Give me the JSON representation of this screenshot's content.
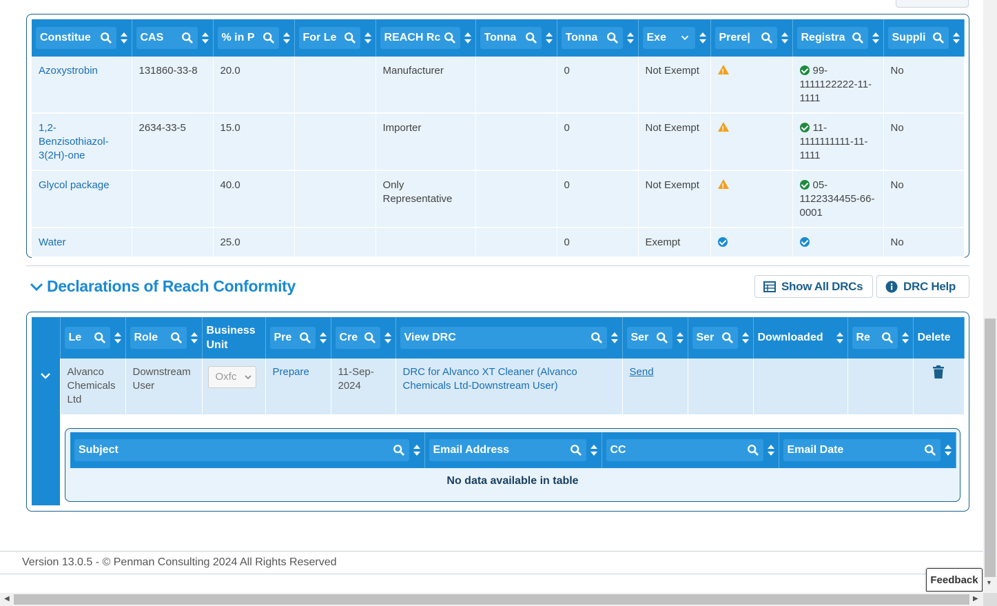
{
  "constituents": {
    "headers": [
      "Constituent",
      "CAS",
      "% in Product",
      "For Legal Entity",
      "REACH Role",
      "Tonnage",
      "Tonnage",
      "Exempt",
      "Prerequisites",
      "Registration",
      "Supplier"
    ],
    "headers_visible": [
      "Constitue",
      "CAS",
      "% in P",
      "For Le",
      "REACH Rc",
      "Tonna",
      "Tonna",
      "Exe",
      "Prere|",
      "Registra",
      "Suppli"
    ],
    "rows": [
      {
        "name": "Azoxystrobin",
        "cas": "131860-33-8",
        "pct": "20.0",
        "for_le": "",
        "reach_role": "Manufacturer",
        "tonnage1": "",
        "tonnage2": "0",
        "exempt": "Not Exempt",
        "prereq": "warning",
        "reg_status": "ok",
        "registration": "99-1111122222-11-1111",
        "supplier": "No"
      },
      {
        "name": "1,2-Benzisothiazol-3(2H)-one",
        "cas": "2634-33-5",
        "pct": "15.0",
        "for_le": "",
        "reach_role": "Importer",
        "tonnage1": "",
        "tonnage2": "0",
        "exempt": "Not Exempt",
        "prereq": "warning",
        "reg_status": "ok",
        "registration": "11-1111111111-11-1111",
        "supplier": "No"
      },
      {
        "name": "Glycol package",
        "cas": "",
        "pct": "40.0",
        "for_le": "",
        "reach_role": "Only Representative",
        "tonnage1": "",
        "tonnage2": "0",
        "exempt": "Not Exempt",
        "prereq": "warning",
        "reg_status": "ok",
        "registration": "05-1122334455-66-0001",
        "supplier": "No"
      },
      {
        "name": "Water",
        "cas": "",
        "pct": "25.0",
        "for_le": "",
        "reach_role": "",
        "tonnage1": "",
        "tonnage2": "0",
        "exempt": "Exempt",
        "prereq": "check",
        "reg_status": "check",
        "registration": "",
        "supplier": "No"
      }
    ]
  },
  "drc_section": {
    "title": "Declarations of Reach Conformity",
    "show_all_label": "Show All DRCs",
    "help_label": "DRC Help",
    "headers_visible": [
      "Le",
      "Role",
      "Business Unit",
      "Pre",
      "Cre",
      "View DRC",
      "Ser",
      "Ser",
      "Downloaded",
      "Re",
      "Delete"
    ],
    "row": {
      "legal_entity": "Alvanco Chemicals Ltd",
      "role": "Downstream User",
      "business_unit": "Oxfc",
      "prepare": "Prepare",
      "created": "11-Sep-2024",
      "view_drc": "DRC for Alvanco XT Cleaner (Alvanco Chemicals Ltd-Downstream User)",
      "send": "Send",
      "sent": "",
      "downloaded": "",
      "received": ""
    },
    "email_table": {
      "headers": [
        "Subject",
        "Email Address",
        "CC",
        "Email Date"
      ],
      "empty_message": "No data available in table"
    }
  },
  "footer": {
    "text": "Version 13.0.5 - © Penman Consulting 2024 All Rights Reserved"
  },
  "feedback_label": "Feedback",
  "colors": {
    "header_blue": "#1a8ad4",
    "row_bg": "#e8f3fb",
    "border_dark": "#1a5f8c",
    "ok_green": "#1e8a3c",
    "warn_orange": "#f0a020"
  }
}
